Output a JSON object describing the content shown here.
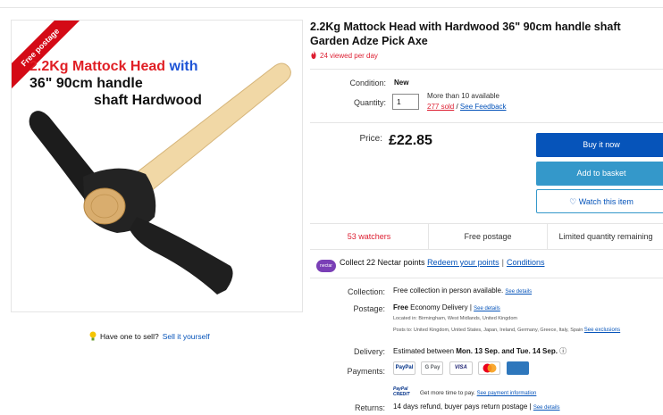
{
  "product": {
    "title": "2.2Kg Mattock Head with Hardwood 36\" 90cm handle shaft Garden Adze Pick Axe",
    "viewed": "24 viewed per day"
  },
  "image": {
    "ribbon": "Free postage",
    "promo_line1_a": "2.2Kg Mattock Head",
    "promo_line1_b": " with",
    "promo_line2": "36\" 90cm handle",
    "promo_line3": "shaft Hardwood"
  },
  "sell": {
    "text": "Have one to sell?",
    "link": "Sell it yourself"
  },
  "details": {
    "condition_label": "Condition:",
    "condition_value": "New",
    "quantity_label": "Quantity:",
    "quantity_value": "1",
    "availability": "More than 10 available",
    "sold": "277 sold",
    "sold_sep": " / ",
    "feedback": "See Feedback",
    "price_label": "Price:",
    "price_value": "£22.85"
  },
  "buttons": {
    "buy_now": "Buy it now",
    "add_basket": "Add to basket",
    "watch": "♡ Watch this item"
  },
  "info_row": {
    "watchers": "53 watchers",
    "postage": "Free postage",
    "limited": "Limited quantity remaining"
  },
  "nectar": {
    "logo": "nectar",
    "text": "Collect 22 Nectar points",
    "redeem": "Redeem your points",
    "sep": "|",
    "conditions": "Conditions"
  },
  "shipping": {
    "collection_label": "Collection:",
    "collection_value": "Free collection in person available.",
    "see_details": "See details",
    "postage_label": "Postage:",
    "postage_free": "Free",
    "postage_method": " Economy Delivery | ",
    "located": "Located in:  Birmingham, West Midlands, United Kingdom",
    "posts_to": "Posts to:  United Kingdom, United States, Japan, Ireland, Germany, Greece, Italy, Spain",
    "see_exclusions": "See exclusions",
    "delivery_label": "Delivery:",
    "delivery_prefix": "Estimated between ",
    "delivery_dates": "Mon. 13 Sep. and Tue. 14 Sep.",
    "delivery_icon": "ⓘ",
    "payments_label": "Payments:",
    "pay_methods": [
      "PayPal",
      "G Pay",
      "VISA",
      "MC",
      "AMEX"
    ],
    "credit_logo": "PayPal CREDIT",
    "credit_text": "Get more time to pay.",
    "credit_link": "See payment information",
    "returns_label": "Returns:",
    "returns_value": "14 days refund, buyer pays return postage | ",
    "returns_link": "See details"
  },
  "colors": {
    "accent_blue": "#0654ba",
    "basket_blue": "#3498ca",
    "alert_red": "#dd1e31",
    "nectar_purple": "#7a3fb6"
  }
}
